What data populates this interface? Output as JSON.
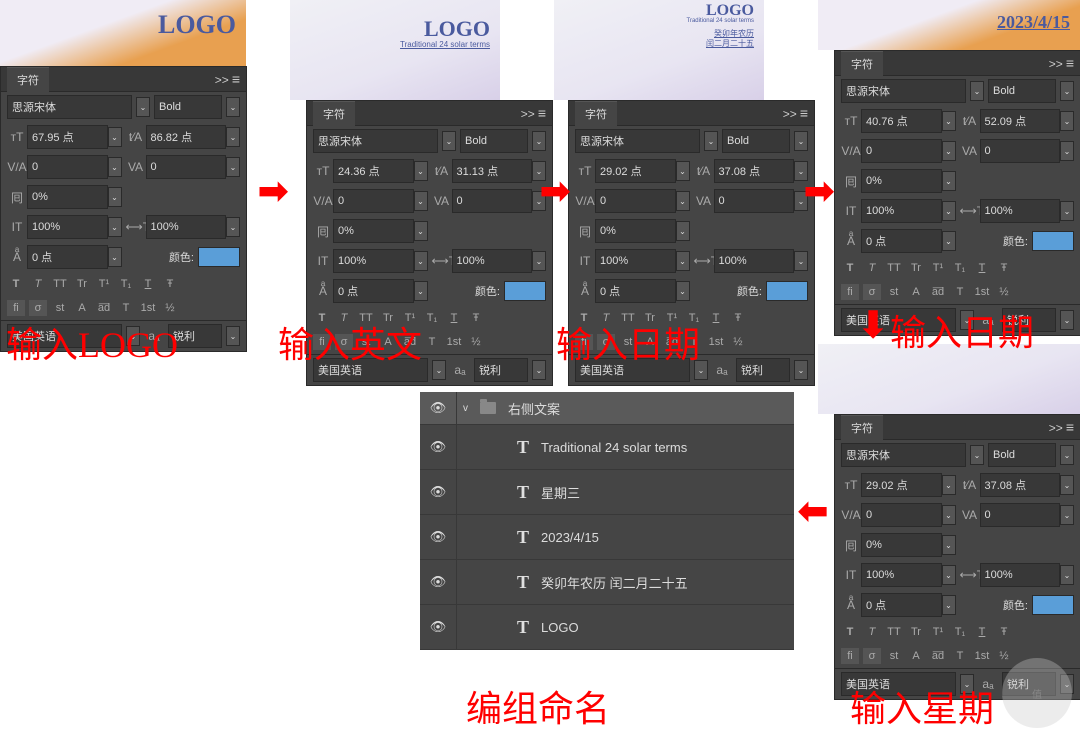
{
  "panel_title": "字符",
  "thumbs": {
    "p1_logo": "LOGO",
    "p2_logo": "LOGO",
    "p2_sub": "Traditional 24 solar terms",
    "p3_logo": "LOGO",
    "p3_sub1": "Traditional 24 solar terms",
    "p3_sub2": "癸卯年农历",
    "p3_sub3": "闰二月二十五",
    "p4_date": "2023/4/15"
  },
  "common": {
    "font_family": "思源宋体",
    "font_weight": "Bold",
    "tracking": "0",
    "kerning": "0",
    "scale": "0%",
    "vscale": "100%",
    "hscale": "100%",
    "baseline": "0 点",
    "color_label": "颜色:",
    "language": "美国英语",
    "antialias": "锐利",
    "aa_icon": "aₐ"
  },
  "panels": {
    "p1": {
      "size": "67.95 点",
      "leading": "86.82 点"
    },
    "p2": {
      "size": "24.36 点",
      "leading": "31.13 点"
    },
    "p3": {
      "size": "29.02 点",
      "leading": "37.08 点"
    },
    "p4": {
      "size": "40.76 点",
      "leading": "52.09 点"
    },
    "p5": {
      "size": "29.02 点",
      "leading": "37.08 点"
    }
  },
  "style_buttons": {
    "row1": [
      "T",
      "T",
      "TT",
      "Tr",
      "T¹",
      "T₁",
      "T",
      "Ŧ"
    ],
    "row2": [
      "fi",
      "σ",
      "st",
      "A",
      "a͞d",
      "T",
      "1st",
      "½"
    ]
  },
  "labels": {
    "l1": "输入LOGO",
    "l2": "输入英文",
    "l3": "输入日期",
    "l4": "输入日期",
    "l5": "编组命名",
    "l6": "输入星期"
  },
  "layers": {
    "group_name": "右侧文案",
    "items": [
      "Traditional 24 solar terms",
      "星期三",
      "2023/4/15",
      "癸卯年农历 闰二月二十五",
      "LOGO"
    ]
  },
  "icons": {
    "expand": ">>",
    "menu": "≡",
    "eye": "👁",
    "chevron_down": "v"
  }
}
